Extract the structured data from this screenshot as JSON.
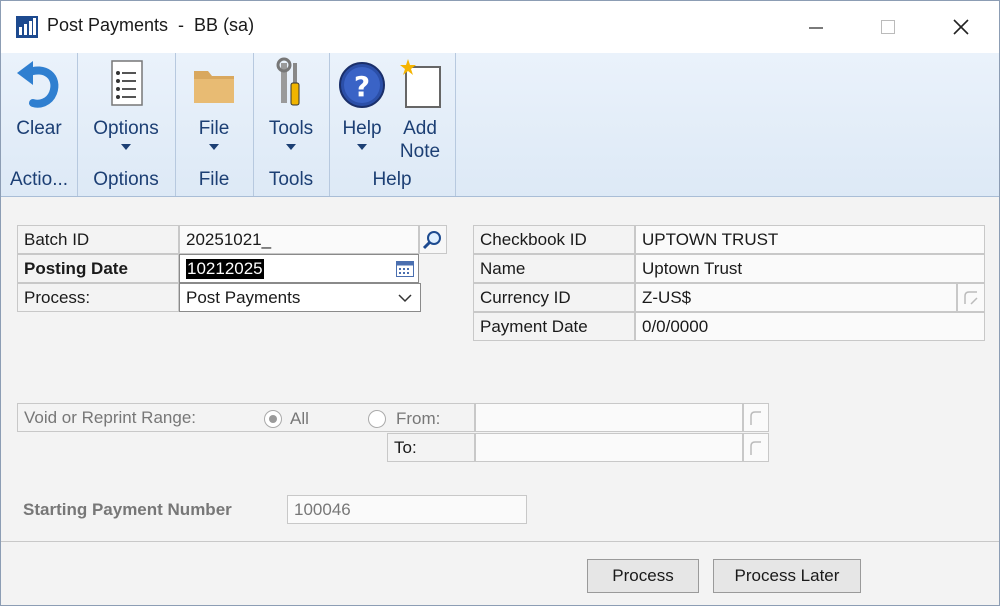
{
  "window": {
    "title": "Post Payments  -  BB (sa)",
    "controls": [
      "minimize",
      "maximize",
      "close"
    ]
  },
  "ribbon": {
    "groups": [
      {
        "label": "Actio...",
        "buttons": [
          {
            "label": "Clear",
            "icon": "undo-arrow-icon"
          }
        ]
      },
      {
        "label": "Options",
        "buttons": [
          {
            "label": "Options",
            "icon": "options-list-icon"
          }
        ]
      },
      {
        "label": "File",
        "buttons": [
          {
            "label": "File",
            "icon": "folder-icon"
          }
        ]
      },
      {
        "label": "Tools",
        "buttons": [
          {
            "label": "Tools",
            "icon": "tools-icon"
          }
        ]
      },
      {
        "label": "Help",
        "buttons": [
          {
            "label": "Help",
            "icon": "help-icon"
          },
          {
            "label": "Add Note",
            "icon": "add-note-icon"
          }
        ]
      }
    ]
  },
  "form": {
    "batch_id_label": "Batch ID",
    "batch_id_value": "20251021_",
    "posting_date_label": "Posting Date",
    "posting_date_value": "10212025",
    "process_label": "Process:",
    "process_value": "Post Payments",
    "checkbook_id_label": "Checkbook ID",
    "checkbook_id_value": "UPTOWN TRUST",
    "name_label": "Name",
    "name_value": "Uptown Trust",
    "currency_id_label": "Currency ID",
    "currency_id_value": "Z-US$",
    "payment_date_label": "Payment Date",
    "payment_date_value": "0/0/0000",
    "void_range_label": "Void or Reprint Range:",
    "radio_all_label": "All",
    "radio_from_label": "From:",
    "to_label": "To:",
    "from_value": "",
    "to_value": "",
    "starting_payment_label": "Starting Payment Number",
    "starting_payment_value": "100046"
  },
  "footer": {
    "process_button": "Process",
    "process_later_button": "Process Later"
  },
  "colors": {
    "ribbon_bg": "#dde9f6",
    "ribbon_text": "#1c3f74",
    "form_bg": "#f3f3f3",
    "selection_bg": "#000000"
  }
}
